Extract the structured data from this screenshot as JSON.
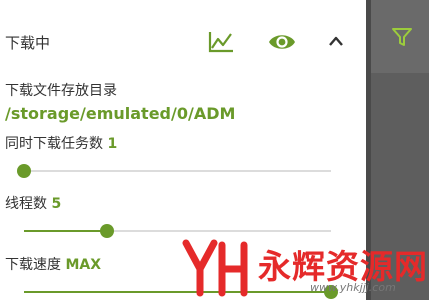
{
  "header": {
    "title": "下载中"
  },
  "settings": {
    "dir_label": "下载文件存放目录",
    "dir_value": "/storage/emulated/0/ADM",
    "tasks_label": "同时下载任务数",
    "tasks_value": "1",
    "tasks_fraction": 0.0,
    "threads_label": "线程数",
    "threads_value": "5",
    "threads_fraction": 0.27,
    "speed_label": "下载速度",
    "speed_value": "MAX",
    "speed_fraction": 1.0
  },
  "watermark": {
    "text": "永辉资源网",
    "url": "www.yhkjjj.com"
  },
  "colors": {
    "accent": "#6a9a2a",
    "rail": "#5e5e5e",
    "watermark": "#e52a2a"
  }
}
